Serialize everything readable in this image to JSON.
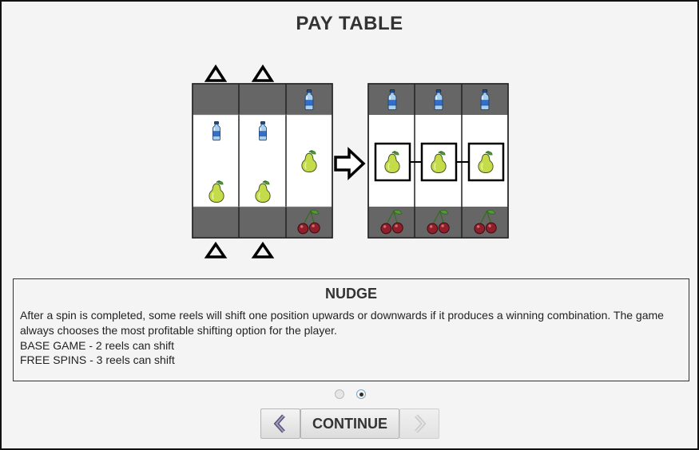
{
  "page": {
    "title": "PAY TABLE"
  },
  "diagram": {
    "before_reels": [
      {
        "top": "",
        "middle": [
          "bottle-icon",
          "pear-icon"
        ],
        "bottom": "",
        "nudge_up": true,
        "nudge_down": true
      },
      {
        "top": "",
        "middle": [
          "bottle-icon",
          "pear-icon"
        ],
        "bottom": "",
        "nudge_up": true,
        "nudge_down": true
      },
      {
        "top": "bottle-icon",
        "middle": [
          "pear-icon"
        ],
        "bottom": "cherries-icon",
        "nudge_up": false,
        "nudge_down": false
      }
    ],
    "after_reels": [
      {
        "top": "bottle-icon",
        "middle": [
          "pear-icon"
        ],
        "bottom": "cherries-icon",
        "win": true
      },
      {
        "top": "bottle-icon",
        "middle": [
          "pear-icon"
        ],
        "bottom": "cherries-icon",
        "win": true
      },
      {
        "top": "bottle-icon",
        "middle": [
          "pear-icon"
        ],
        "bottom": "cherries-icon",
        "win": true
      }
    ]
  },
  "info": {
    "title": "NUDGE",
    "lines": [
      "After a spin is completed, some reels will shift one position upwards or downwards if it produces a winning combination. The game",
      "always chooses the most profitable shifting option for the player.",
      "BASE GAME - 2 reels can shift",
      "FREE SPINS - 3 reels can shift"
    ]
  },
  "pagination": {
    "pages": 2,
    "current": 2
  },
  "buttons": {
    "continue_label": "CONTINUE",
    "prev_enabled": true,
    "next_enabled": false
  },
  "colors": {
    "panel": "#f4f4f4",
    "reel_shade": "#666666",
    "pear": "#c5dc4a",
    "cherry": "#8f1f2b",
    "bottle": "#3b7fd0"
  }
}
